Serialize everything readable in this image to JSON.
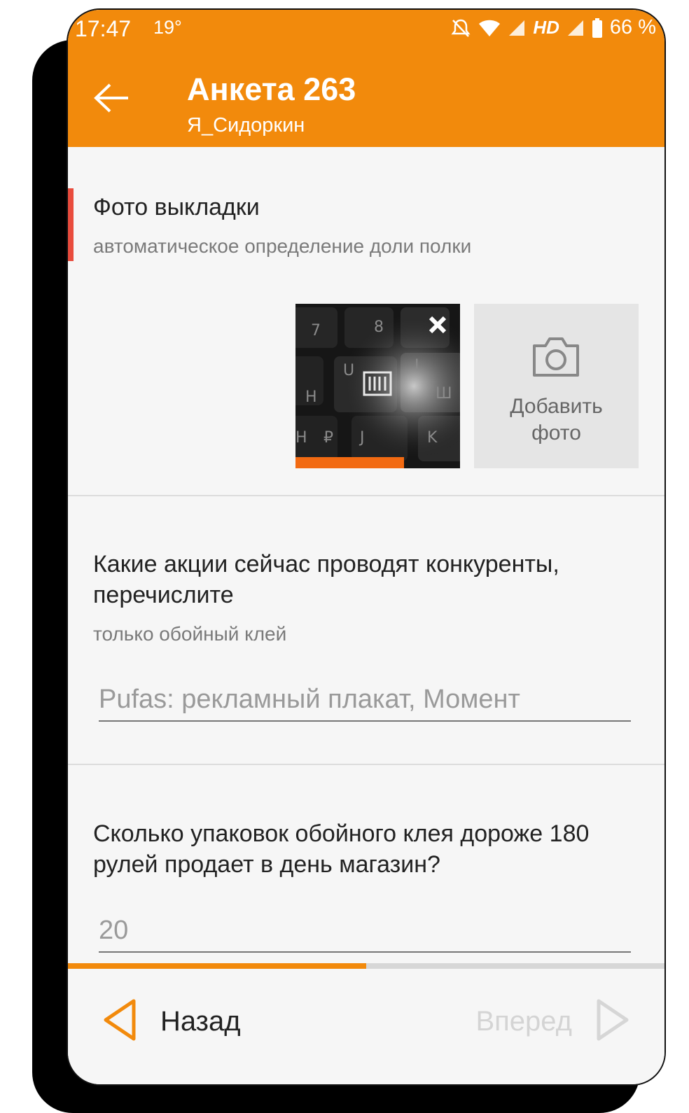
{
  "status_bar": {
    "time": "17:47",
    "temperature": "19°",
    "network_label": "HD",
    "battery": "66 %"
  },
  "header": {
    "title": "Анкета 263",
    "subtitle": "Я_Сидоркин"
  },
  "photo_question": {
    "title": "Фото выкладки",
    "subtitle": "автоматическое определение доли полки",
    "upload_progress": 0.66,
    "add_photo_label_line1": "Добавить",
    "add_photo_label_line2": "фото"
  },
  "question_2": {
    "title": "Какие акции сейчас проводят конкуренты, перечислите",
    "subtitle": "только обойный клей",
    "answer": "Pufas: рекламный плакат, Момент"
  },
  "question_3": {
    "title": "Сколько упаковок обойного клея дороже 180 рулей продает в день магазин?",
    "answer": "20"
  },
  "survey_progress": 0.5,
  "bottom_nav": {
    "back_label": "Назад",
    "forward_label": "Вперед"
  },
  "colors": {
    "accent": "#f28a0c",
    "required_marker": "#e94c3d"
  }
}
